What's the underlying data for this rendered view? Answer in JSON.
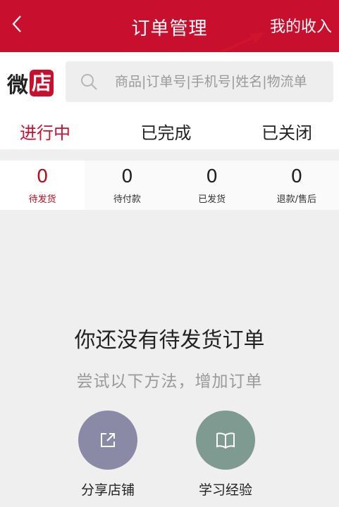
{
  "header": {
    "title": "订单管理",
    "right_link": "我的收入",
    "back_icon": "chevron-left-icon",
    "bg_color": "#c8102e"
  },
  "logo": {
    "char1": "微",
    "char2": "店"
  },
  "search": {
    "placeholder": "商品|订单号|手机号|姓名|物流单",
    "icon": "search-icon"
  },
  "tabs": [
    {
      "label": "进行中",
      "active": true
    },
    {
      "label": "已完成",
      "active": false
    },
    {
      "label": "已关闭",
      "active": false
    }
  ],
  "status": [
    {
      "count": "0",
      "label": "待发货",
      "active": true
    },
    {
      "count": "0",
      "label": "待付款",
      "active": false
    },
    {
      "count": "0",
      "label": "已发货",
      "active": false
    },
    {
      "count": "0",
      "label": "退款/售后",
      "active": false
    }
  ],
  "empty": {
    "title": "你还没有待发货订单",
    "subtitle": "尝试以下方法，增加订单"
  },
  "actions": [
    {
      "label": "分享店铺",
      "icon": "share-icon",
      "color": "#8a8aa6"
    },
    {
      "label": "学习经验",
      "icon": "book-icon",
      "color": "#7e9a91"
    }
  ],
  "accent_color": "#c8102e"
}
